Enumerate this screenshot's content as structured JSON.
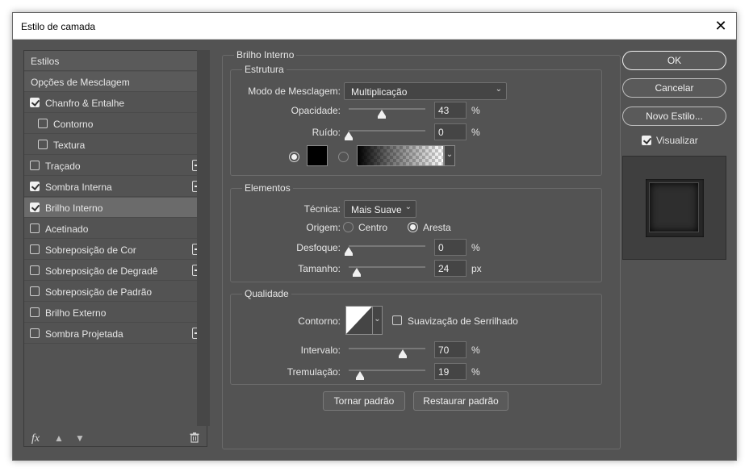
{
  "window": {
    "title": "Estilo de camada"
  },
  "style_list": {
    "items": [
      {
        "label": "Estilos"
      },
      {
        "label": "Opções de Mesclagem"
      },
      {
        "label": "Chanfro & Entalhe",
        "checked": true
      },
      {
        "label": "Contorno",
        "checked": false
      },
      {
        "label": "Textura",
        "checked": false
      },
      {
        "label": "Traçado",
        "checked": false
      },
      {
        "label": "Sombra Interna",
        "checked": true
      },
      {
        "label": "Brilho Interno",
        "checked": true
      },
      {
        "label": "Acetinado",
        "checked": false
      },
      {
        "label": "Sobreposição de Cor",
        "checked": false
      },
      {
        "label": "Sobreposição de Degradê",
        "checked": false
      },
      {
        "label": "Sobreposição de Padrão",
        "checked": false
      },
      {
        "label": "Brilho Externo",
        "checked": false
      },
      {
        "label": "Sombra Projetada",
        "checked": false
      }
    ],
    "footer": {
      "fx": "fx"
    }
  },
  "panel": {
    "title": "Brilho Interno",
    "estrutura": {
      "title": "Estrutura",
      "blend_label": "Modo de Mesclagem:",
      "blend_value": "Multiplicação",
      "opacity_label": "Opacidade:",
      "opacity_value": "43",
      "opacity_fraction": 0.43,
      "noise_label": "Ruído:",
      "noise_value": "0",
      "noise_fraction": 0.0,
      "percent": "%",
      "color": "#000000"
    },
    "elementos": {
      "title": "Elementos",
      "technique_label": "Técnica:",
      "technique_value": "Mais Suave",
      "source_label": "Origem:",
      "source_center": "Centro",
      "source_edge": "Aresta",
      "choke_label": "Desfoque:",
      "choke_value": "0",
      "choke_fraction": 0.0,
      "size_label": "Tamanho:",
      "size_value": "24",
      "size_fraction": 0.1,
      "percent": "%",
      "px": "px"
    },
    "qualidade": {
      "title": "Qualidade",
      "contour_label": "Contorno:",
      "antialias_label": "Suavização de Serrilhado",
      "range_label": "Intervalo:",
      "range_value": "70",
      "range_fraction": 0.7,
      "jitter_label": "Tremulação:",
      "jitter_value": "19",
      "jitter_fraction": 0.15,
      "percent": "%"
    },
    "make_default": "Tornar padrão",
    "reset_default": "Restaurar padrão"
  },
  "actions": {
    "ok": "OK",
    "cancel": "Cancelar",
    "new_style": "Novo Estilo...",
    "preview_label": "Visualizar"
  }
}
